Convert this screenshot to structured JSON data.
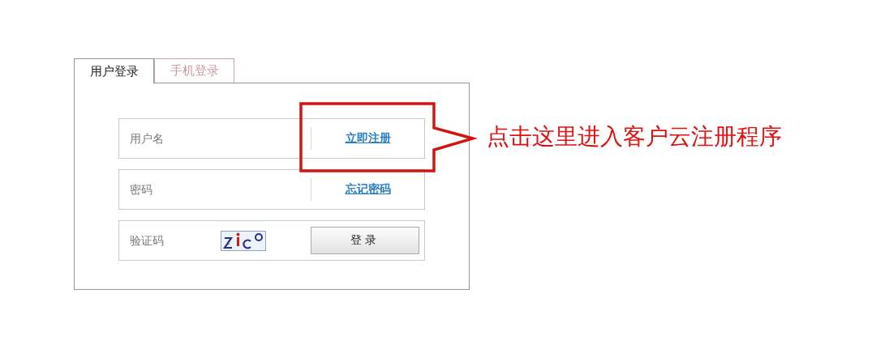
{
  "tabs": [
    {
      "label": "用户登录",
      "selected": true
    },
    {
      "label": "手机登录",
      "selected": false
    }
  ],
  "form": {
    "fields": [
      {
        "kind": "text",
        "placeholder": "用户名",
        "link": "立即注册"
      },
      {
        "kind": "password",
        "placeholder": "密码",
        "link": "忘记密码"
      },
      {
        "kind": "captcha",
        "placeholder": "验证码",
        "button": "登录"
      }
    ]
  },
  "callout": {
    "text": "点击这里进入客户云注册程序"
  }
}
